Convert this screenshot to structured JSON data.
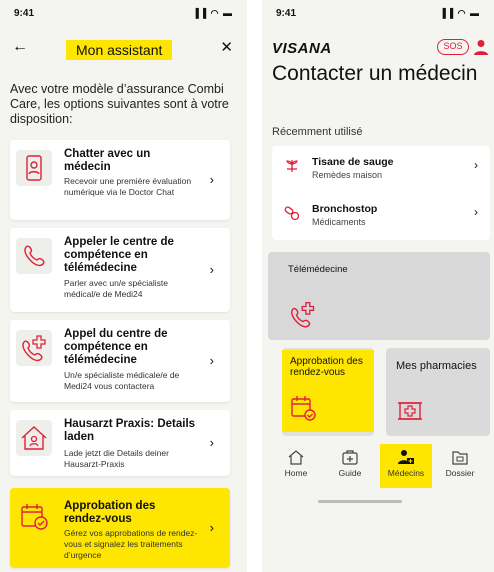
{
  "left": {
    "status_time": "9:41",
    "status_icons": "▐▐ ◠ ▬",
    "back_icon": "←",
    "close_icon": "✕",
    "title": "Mon assistant",
    "intro": "Avec votre modèle d’assurance Combi Care, les options suivantes sont à votre disposition:",
    "cards": [
      {
        "title": "Chatter avec un médecin",
        "desc": "Recevoir une première évaluation numérique via le Doctor Chat",
        "icon": "phone-doctor-icon"
      },
      {
        "title": "Appeler le centre de compétence en télémédecine",
        "desc": "Parler avec un/e spécialiste médical/e de Medi24",
        "icon": "phone-handset-icon"
      },
      {
        "title": "Appel du centre de compétence en télémédecine",
        "desc": "Un/e spécialiste médicale/e de Medi24 vous contactera",
        "icon": "phone-medical-cross-icon"
      },
      {
        "title": "Hausarzt Praxis: Details laden",
        "desc": "Lade jetzt die Details deiner Hausarzt-Praxis",
        "icon": "house-doctor-icon"
      },
      {
        "title": "Approbation des rendez-vous",
        "desc": "Gérez vos approbations de rendez-vous et signalez les traitements d’urgence",
        "icon": "calendar-check-icon"
      }
    ],
    "chevron": "›",
    "highlight_color": "#ffe600"
  },
  "right": {
    "status_time": "9:41",
    "status_icons": "▐▐ ◠ ▬",
    "logo": "VISANA",
    "sos": "SOS",
    "title": "Contacter un médecin",
    "recent_label": "Récemment utilisé",
    "recent_items": [
      {
        "name": "Tisane de sauge",
        "sub": "Remèdes maison",
        "icon": "herb-icon"
      },
      {
        "name": "Bronchostop",
        "sub": "Médicaments",
        "icon": "pills-icon"
      }
    ],
    "telemedicine_label": "Télémédecine",
    "tile_approbation": "Approbation des rendez-vous",
    "tile_pharmacies": "Mes pharmacies",
    "tabs": [
      {
        "label": "Home",
        "icon": "home-icon"
      },
      {
        "label": "Guide",
        "icon": "first-aid-kit-icon"
      },
      {
        "label": "Médecins",
        "icon": "doctor-icon",
        "active": true
      },
      {
        "label": "Dossier",
        "icon": "folder-icon"
      }
    ],
    "accent_red": "#e0203a"
  }
}
